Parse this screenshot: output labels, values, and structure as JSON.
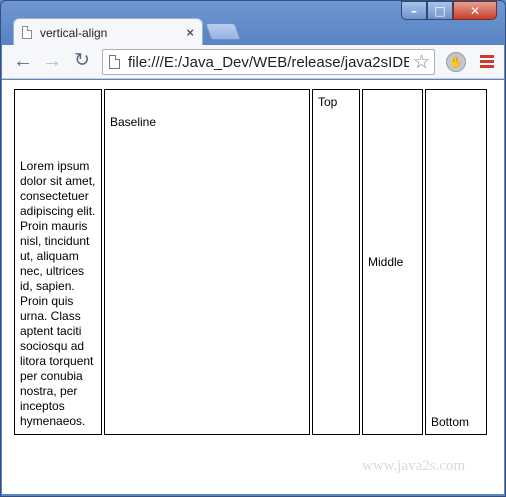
{
  "browser": {
    "tab_title": "vertical-align",
    "tab_close": "×",
    "url": "file:///E:/Java_Dev/WEB/release/java2sIDE",
    "controls": {
      "minimize": "–",
      "maximize": "□",
      "close": "✕"
    }
  },
  "content": {
    "lorem": "Lorem ipsum dolor sit amet, consectetuer adipiscing elit. Proin mauris nisl, tincidunt ut, aliquam nec, ultrices id, sapien. Proin quis urna. Class aptent taciti sociosqu ad litora torquent per conubia nostra, per inceptos hymenaeos.",
    "baseline": "Baseline",
    "top": "Top",
    "middle": "Middle",
    "bottom": "Bottom"
  },
  "watermark": "www.java2s.com"
}
